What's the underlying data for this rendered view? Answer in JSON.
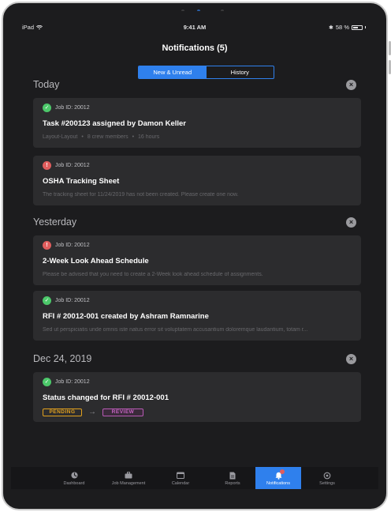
{
  "status_bar": {
    "device": "iPad",
    "time": "9:41 AM",
    "battery_text": "58 %",
    "battery_level": 0.58
  },
  "header": {
    "title": "Notifications (5)"
  },
  "segmented": {
    "tabs": [
      {
        "label": "New & Unread",
        "active": true
      },
      {
        "label": "History",
        "active": false
      }
    ]
  },
  "sections": [
    {
      "title": "Today",
      "cards": [
        {
          "status": "ok",
          "job": "Job ID: 20012",
          "title": "Task #200123 assigned by Damon Keller",
          "desc_parts": [
            "Layout-Layout",
            "8 crew members",
            "16 hours"
          ]
        },
        {
          "status": "alert",
          "job": "Job ID: 20012",
          "title": "OSHA Tracking Sheet",
          "desc": "The tracking sheet for 11/24/2019 has not been created. Please create one now."
        }
      ]
    },
    {
      "title": "Yesterday",
      "cards": [
        {
          "status": "alert",
          "job": "Job ID: 20012",
          "title": "2-Week Look Ahead Schedule",
          "desc": "Please be advised that you need to create a 2-Week look ahead schedule of assignments."
        },
        {
          "status": "ok",
          "job": "Job ID: 20012",
          "title": "RFI # 20012-001 created by Ashram Ramnarine",
          "desc": "Sed ut perspiciatis unde omnis iste natus error sit voluptatem accusantium doloremque laudantium, totam r..."
        }
      ]
    },
    {
      "title": "Dec 24, 2019",
      "cards": [
        {
          "status": "ok",
          "job": "Job ID: 20012",
          "title": "Status changed for RFI # 20012-001",
          "badges": {
            "from": "PENDING",
            "to": "REVIEW"
          }
        }
      ]
    }
  ],
  "tab_bar": {
    "items": [
      {
        "label": "Dashboard",
        "icon": "dashboard-icon"
      },
      {
        "label": "Job Management",
        "icon": "briefcase-icon"
      },
      {
        "label": "Calendar",
        "icon": "calendar-icon"
      },
      {
        "label": "Reports",
        "icon": "report-icon"
      },
      {
        "label": "Notifications",
        "icon": "bell-icon",
        "active": true
      },
      {
        "label": "Settings",
        "icon": "gear-icon"
      }
    ]
  },
  "colors": {
    "accent": "#2f80ed",
    "ok": "#4cc86a",
    "alert": "#e05d5d",
    "pending": "#e2a11e",
    "review": "#c764c4"
  }
}
